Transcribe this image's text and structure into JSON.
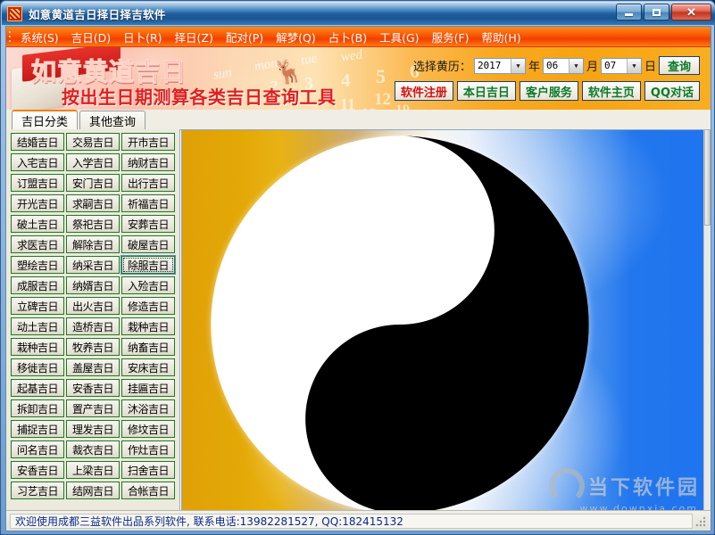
{
  "window": {
    "title": "如意黄道吉日择日择吉软件",
    "app_icon": "calendar-icon",
    "minimize_label": "最小化",
    "maximize_label": "最大化",
    "close_label": "✕"
  },
  "menubar": {
    "items": [
      {
        "label": "系统(S)"
      },
      {
        "label": "吉日(D)"
      },
      {
        "label": "日卜(R)"
      },
      {
        "label": "择日(Z)"
      },
      {
        "label": "配对(P)"
      },
      {
        "label": "解梦(Q)"
      },
      {
        "label": "占卜(B)"
      },
      {
        "label": "工具(G)"
      },
      {
        "label": "服务(F)"
      },
      {
        "label": "帮助(H)"
      }
    ]
  },
  "banner": {
    "title": "如意黄道吉日",
    "subtitle": "按出生日期测算各类吉日查询工具",
    "dove_icon": "dove-icon",
    "calendar_words": [
      "sun",
      "mon",
      "tue",
      "wed"
    ],
    "calendar_numbers": [
      "2",
      "3",
      "4",
      "5",
      "6",
      "11",
      "12",
      "13",
      "18",
      "19"
    ]
  },
  "date_selector": {
    "label": "选择黄历：",
    "year_value": "2017",
    "year_unit": "年",
    "month_value": "06",
    "month_unit": "月",
    "day_value": "07",
    "day_unit": "日",
    "query_button": "查询"
  },
  "action_buttons": [
    {
      "label": "软件注册",
      "color": "#d31212"
    },
    {
      "label": "本日吉日",
      "color": "#0a7a2a"
    },
    {
      "label": "客户服务",
      "color": "#0a7a2a"
    },
    {
      "label": "软件主页",
      "color": "#0a7a2a"
    },
    {
      "label": "QQ对话",
      "color": "#0a7a2a"
    }
  ],
  "tabs": [
    {
      "label": "吉日分类",
      "active": true
    },
    {
      "label": "其他查询",
      "active": false
    }
  ],
  "category_buttons": [
    {
      "label": "结婚吉日",
      "focused": false
    },
    {
      "label": "交易吉日",
      "focused": false
    },
    {
      "label": "开市吉日",
      "focused": false
    },
    {
      "label": "入宅吉日",
      "focused": false
    },
    {
      "label": "入学吉日",
      "focused": false
    },
    {
      "label": "纳财吉日",
      "focused": false
    },
    {
      "label": "订盟吉日",
      "focused": false
    },
    {
      "label": "安门吉日",
      "focused": false
    },
    {
      "label": "出行吉日",
      "focused": false
    },
    {
      "label": "开光吉日",
      "focused": false
    },
    {
      "label": "求嗣吉日",
      "focused": false
    },
    {
      "label": "祈福吉日",
      "focused": false
    },
    {
      "label": "破土吉日",
      "focused": false
    },
    {
      "label": "祭祀吉日",
      "focused": false
    },
    {
      "label": "安葬吉日",
      "focused": false
    },
    {
      "label": "求医吉日",
      "focused": false
    },
    {
      "label": "解除吉日",
      "focused": false
    },
    {
      "label": "破屋吉日",
      "focused": false
    },
    {
      "label": "塑绘吉日",
      "focused": false
    },
    {
      "label": "纳采吉日",
      "focused": false
    },
    {
      "label": "除服吉日",
      "focused": true
    },
    {
      "label": "成服吉日",
      "focused": false
    },
    {
      "label": "纳婿吉日",
      "focused": false
    },
    {
      "label": "入殓吉日",
      "focused": false
    },
    {
      "label": "立碑吉日",
      "focused": false
    },
    {
      "label": "出火吉日",
      "focused": false
    },
    {
      "label": "修造吉日",
      "focused": false
    },
    {
      "label": "动土吉日",
      "focused": false
    },
    {
      "label": "造桥吉日",
      "focused": false
    },
    {
      "label": "栽种吉日",
      "focused": false
    },
    {
      "label": "栽种吉日",
      "focused": false
    },
    {
      "label": "牧养吉日",
      "focused": false
    },
    {
      "label": "纳畜吉日",
      "focused": false
    },
    {
      "label": "移徙吉日",
      "focused": false
    },
    {
      "label": "盖屋吉日",
      "focused": false
    },
    {
      "label": "安床吉日",
      "focused": false
    },
    {
      "label": "起基吉日",
      "focused": false
    },
    {
      "label": "安香吉日",
      "focused": false
    },
    {
      "label": "挂匾吉日",
      "focused": false
    },
    {
      "label": "拆卸吉日",
      "focused": false
    },
    {
      "label": "置产吉日",
      "focused": false
    },
    {
      "label": "沐浴吉日",
      "focused": false
    },
    {
      "label": "捕捉吉日",
      "focused": false
    },
    {
      "label": "理发吉日",
      "focused": false
    },
    {
      "label": "修坟吉日",
      "focused": false
    },
    {
      "label": "问名吉日",
      "focused": false
    },
    {
      "label": "裁衣吉日",
      "focused": false
    },
    {
      "label": "作灶吉日",
      "focused": false
    },
    {
      "label": "安香吉日",
      "focused": false
    },
    {
      "label": "上梁吉日",
      "focused": false
    },
    {
      "label": "扫舍吉日",
      "focused": false
    },
    {
      "label": "习艺吉日",
      "focused": false
    },
    {
      "label": "结网吉日",
      "focused": false
    },
    {
      "label": "合帐吉日",
      "focused": false
    }
  ],
  "content": {
    "image_name": "yin-yang-taiji-symbol",
    "watermark_text": "当下软件园",
    "watermark_url": "www.downxia.com"
  },
  "statusbar": {
    "message": "欢迎使用成都三益软件出品系列软件, 联系电话:13982281527, QQ:182415132"
  },
  "colors": {
    "menu_orange": "#f55d05",
    "title_blue": "#1f5e9e",
    "button_green": "#1f7a1f",
    "register_red": "#d31212",
    "status_blue": "#0b2a8a"
  }
}
